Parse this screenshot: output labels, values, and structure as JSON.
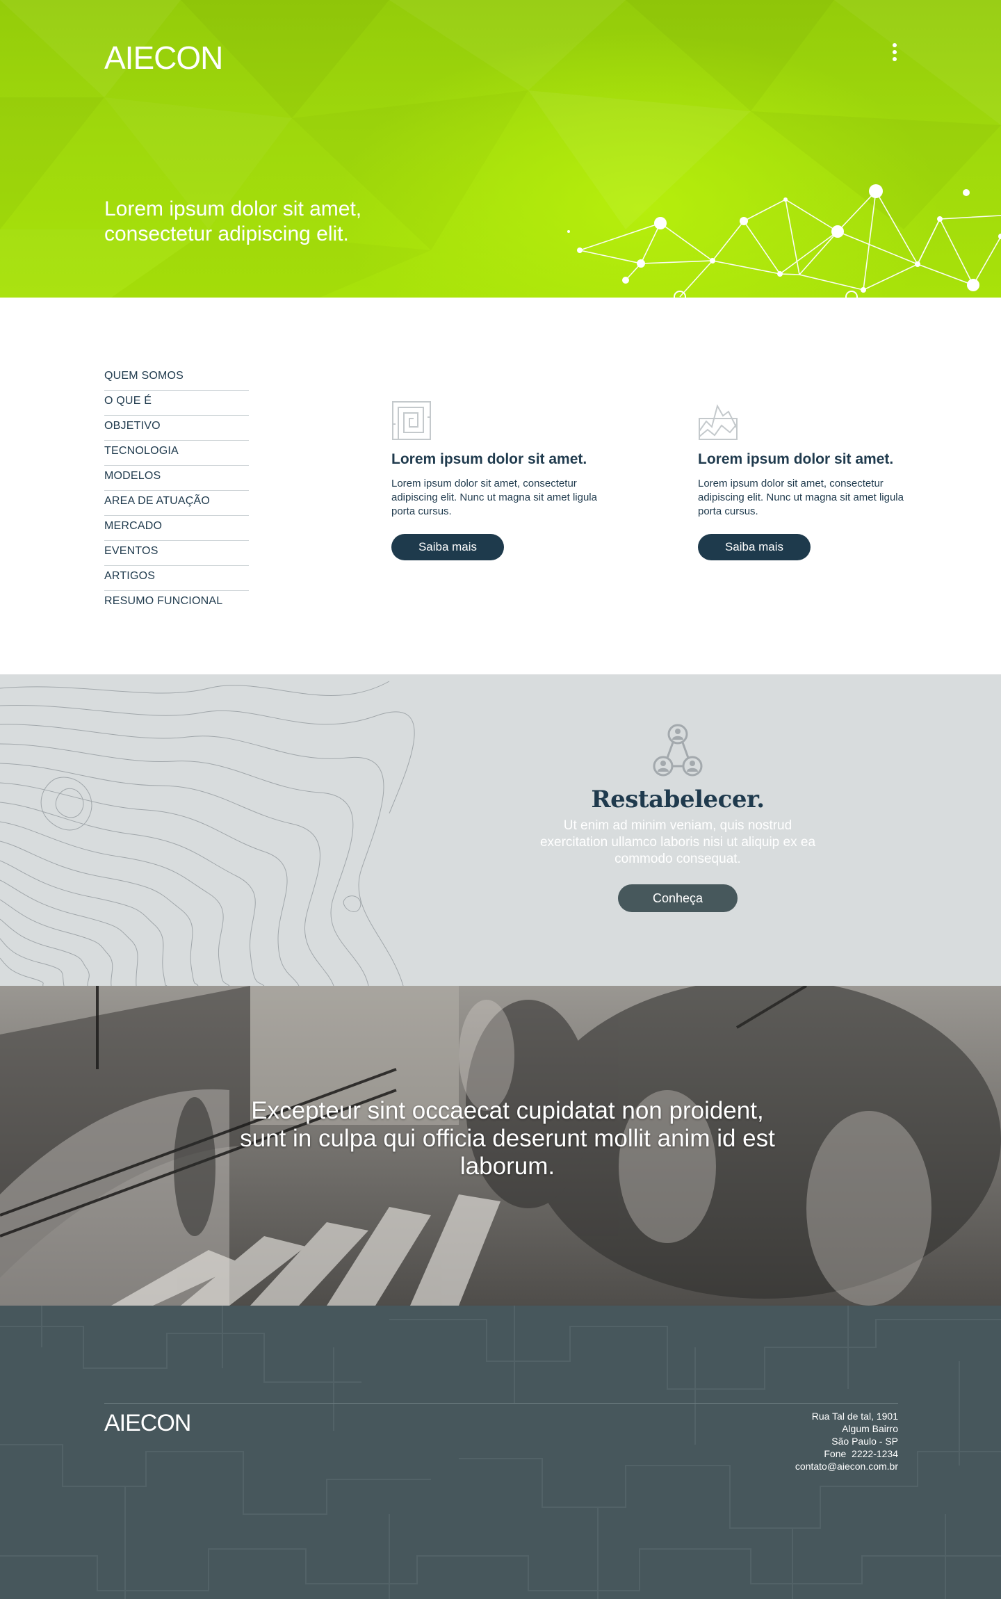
{
  "header": {
    "logo": "AIECON",
    "menu_icon": "vertical-dots-icon",
    "tagline_line1": "Lorem ipsum dolor sit amet,",
    "tagline_line2": "consectetur adipiscing elit.",
    "background_color": "#a2dc0c"
  },
  "side_nav": {
    "items": [
      {
        "label": "QUEM SOMOS"
      },
      {
        "label": "O QUE É"
      },
      {
        "label": "OBJETIVO"
      },
      {
        "label": "TECNOLOGIA"
      },
      {
        "label": "MODELOS"
      },
      {
        "label": "AREA DE ATUAÇÃO"
      },
      {
        "label": "MERCADO"
      },
      {
        "label": "EVENTOS"
      },
      {
        "label": "ARTIGOS"
      },
      {
        "label": "RESUMO FUNCIONAL"
      }
    ]
  },
  "cards": [
    {
      "icon": "maze-icon",
      "title": "Lorem ipsum dolor sit amet.",
      "text": "Lorem ipsum dolor sit amet, consectetur adipiscing elit. Nunc ut magna sit amet ligula porta cursus.",
      "button": "Saiba mais"
    },
    {
      "icon": "mountain-chart-icon",
      "title": "Lorem ipsum dolor sit amet.",
      "text": "Lorem ipsum dolor sit amet, consectetur adipiscing elit. Nunc ut magna sit amet ligula porta cursus.",
      "button": "Saiba mais"
    }
  ],
  "restabelecer": {
    "icon": "people-network-icon",
    "title": "Restabelecer.",
    "text": "Ut enim ad minim veniam, quis nostrud exercitation ullamco laboris nisi ut aliquip ex ea commodo consequat.",
    "button": "Conheça"
  },
  "photo_band": {
    "quote": "Excepteur sint occaecat cupidatat non proident, sunt in culpa qui officia deserunt mollit anim id est laborum."
  },
  "footer": {
    "logo": "AIECON",
    "address": {
      "street": "Rua Tal de tal, 1901",
      "district": "Algum Bairro",
      "city": "São Paulo - SP",
      "phone": "Fone  2222-1234",
      "email": "contato@aiecon.com.br"
    }
  },
  "colors": {
    "accent_green": "#a2dc0c",
    "navy": "#1e3a4c",
    "band_gray": "#d8dcdd",
    "slate": "#47585c",
    "footer_bg": "#47575c"
  }
}
